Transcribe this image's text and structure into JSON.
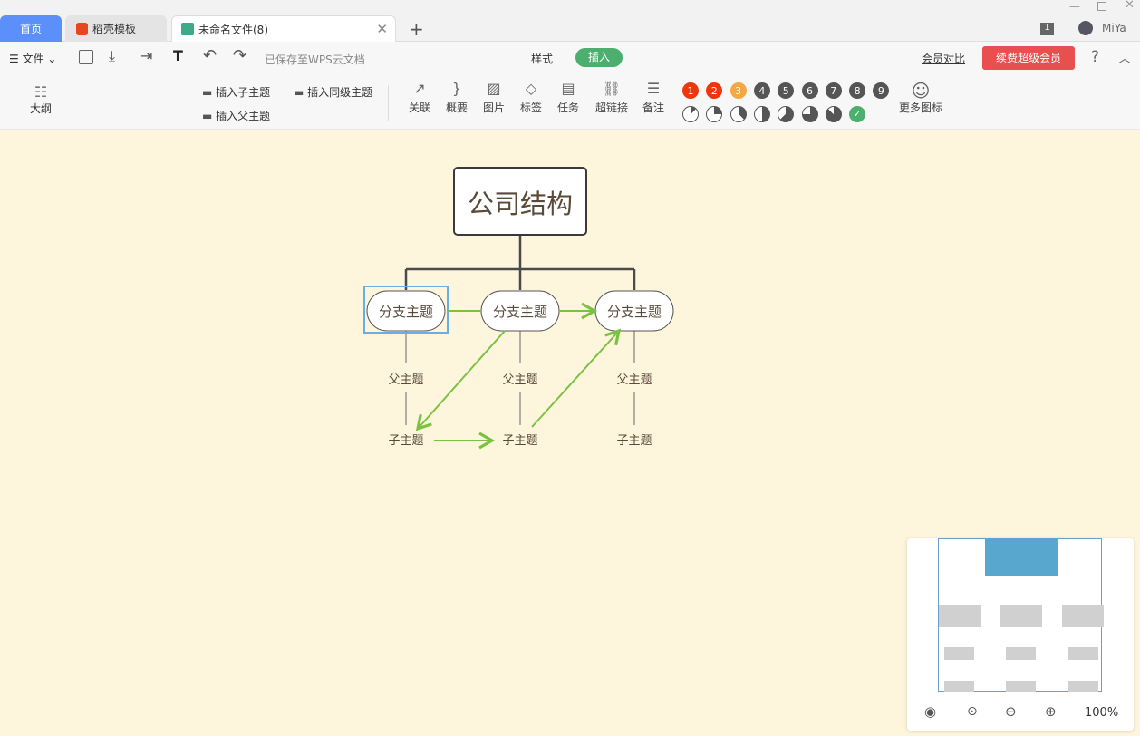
{
  "tabs": [
    {
      "label": "首页",
      "active": false
    },
    {
      "label": "稻壳模板",
      "active": false
    },
    {
      "label": "未命名文件(8)",
      "active": true
    }
  ],
  "window": {
    "badge": "1",
    "user": "MiYa"
  },
  "menu": {
    "file": "文件",
    "saved_status": "已保存至WPS云文档",
    "style_tab": "样式",
    "insert_tab": "插入",
    "member_compare": "会员对比",
    "renew_button": "续费超级会员",
    "help": "?"
  },
  "toolbar": {
    "outline": "大纲",
    "insert_child": "插入子主题",
    "insert_sibling": "插入同级主题",
    "insert_parent": "插入父主题",
    "tools": [
      {
        "label": "关联",
        "icon": "relation-arrow-icon"
      },
      {
        "label": "概要",
        "icon": "summary-brace-icon"
      },
      {
        "label": "图片",
        "icon": "image-icon"
      },
      {
        "label": "标签",
        "icon": "tag-icon"
      },
      {
        "label": "任务",
        "icon": "task-icon"
      },
      {
        "label": "超链接",
        "icon": "link-icon"
      },
      {
        "label": "备注",
        "icon": "note-icon"
      }
    ],
    "priorities": [
      "1",
      "2",
      "3",
      "4",
      "5",
      "6",
      "7",
      "8",
      "9"
    ],
    "priority_colors": [
      "#f0340c",
      "#f0340c",
      "#f4a742",
      "#555555",
      "#555555",
      "#555555",
      "#555555",
      "#555555",
      "#555555"
    ],
    "progress_levels": [
      0.125,
      0.25,
      0.375,
      0.5,
      0.625,
      0.75,
      0.875,
      1.0
    ],
    "more_icons": "更多图标"
  },
  "mindmap": {
    "root": "公司结构",
    "branches": [
      {
        "label": "分支主题",
        "parent": "父主题",
        "child": "子主题",
        "selected": true
      },
      {
        "label": "分支主题",
        "parent": "父主题",
        "child": "子主题",
        "selected": false
      },
      {
        "label": "分支主题",
        "parent": "父主题",
        "child": "子主题",
        "selected": false
      }
    ],
    "relation_color": "#7cc241",
    "selection_color": "#6aaee8"
  },
  "minimap": {
    "zoom": "100%"
  },
  "colors": {
    "canvas": "#fdf5dc",
    "accent_green": "#4caf6e",
    "renew_red": "#e84f4f",
    "home_tab": "#5b8ff9"
  }
}
